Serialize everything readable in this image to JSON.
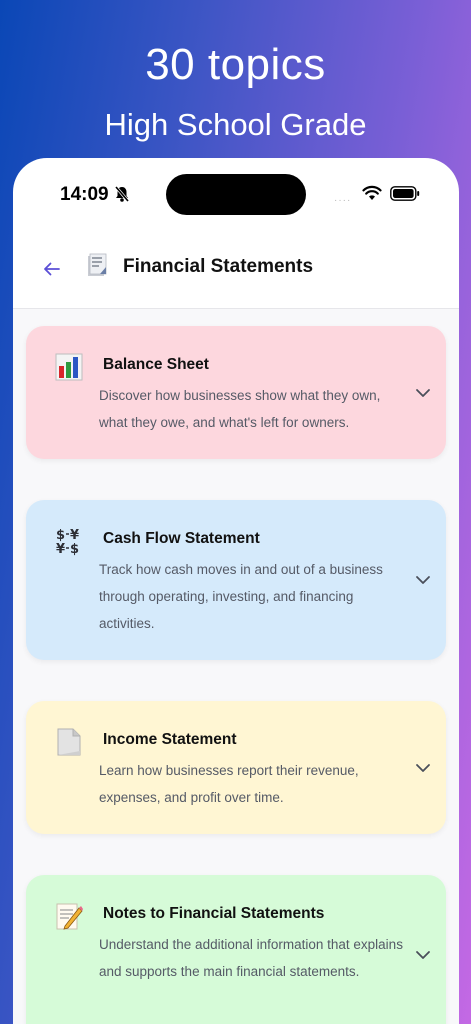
{
  "hero": {
    "title": "30 topics",
    "subtitle": "High School Grade"
  },
  "status_bar": {
    "time": "14:09",
    "signal": "····"
  },
  "nav": {
    "title": "Financial Statements",
    "back_icon": "back-arrow-icon",
    "topic_icon": "document-icon"
  },
  "cards": [
    {
      "title": "Balance Sheet",
      "description": "Discover how businesses show what they own, what they owe, and what's left for owners.",
      "icon": "bar-chart-icon",
      "color": "#fdd7de"
    },
    {
      "title": "Cash Flow Statement",
      "description": "Track how cash moves in and out of a business through operating, investing, and financing activities.",
      "icon": "currency-exchange-icon",
      "color": "#d5eafb"
    },
    {
      "title": "Income Statement",
      "description": "Learn how businesses report their revenue, expenses, and profit over time.",
      "icon": "page-icon",
      "color": "#fff6d3"
    },
    {
      "title": "Notes to Financial Statements",
      "description": "Understand the additional information that explains and supports the main financial statements.",
      "icon": "memo-icon",
      "color": "#d6fbd8"
    }
  ],
  "colors": {
    "accent": "#5b4fd6",
    "gradient_start": "#0a47b6",
    "gradient_end": "#c469e4"
  }
}
